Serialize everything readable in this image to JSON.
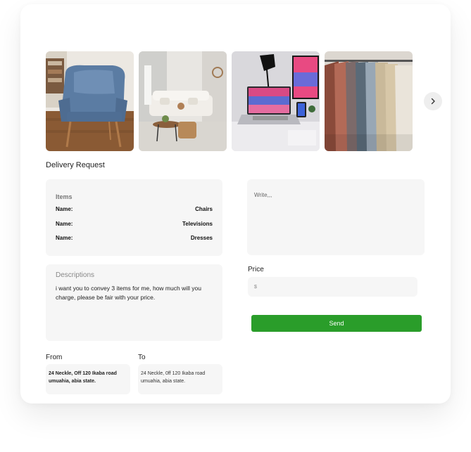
{
  "gallery": {
    "images": [
      {
        "name": "chair-image"
      },
      {
        "name": "living-room-image"
      },
      {
        "name": "desk-laptop-image"
      },
      {
        "name": "clothes-rack-image"
      }
    ],
    "next_icon": "chevron-right-icon"
  },
  "request": {
    "title": "Delivery Request",
    "items": {
      "title": "Items",
      "rows": [
        {
          "key": "Name:",
          "value": "Chairs"
        },
        {
          "key": "Name:",
          "value": "Televisions"
        },
        {
          "key": "Name:",
          "value": "Dresses"
        }
      ]
    },
    "description": {
      "label": "Descriptions",
      "text": "i want you to convey 3 items for me, how much will you charge, please be fair with your price."
    },
    "message": {
      "placeholder": "Write,,,"
    },
    "price": {
      "label": "Price",
      "placeholder": "$"
    },
    "send_label": "Send",
    "from": {
      "label": "From",
      "address": "24 Neckle, Off 120 Ikaba road umuahia, abia state."
    },
    "to": {
      "label": "To",
      "address": "24 Neckle, 0ff 120 Ikaba road umuahia, abia state."
    }
  },
  "colors": {
    "accent": "#2a9d2a",
    "panel_bg": "#f6f6f6"
  }
}
